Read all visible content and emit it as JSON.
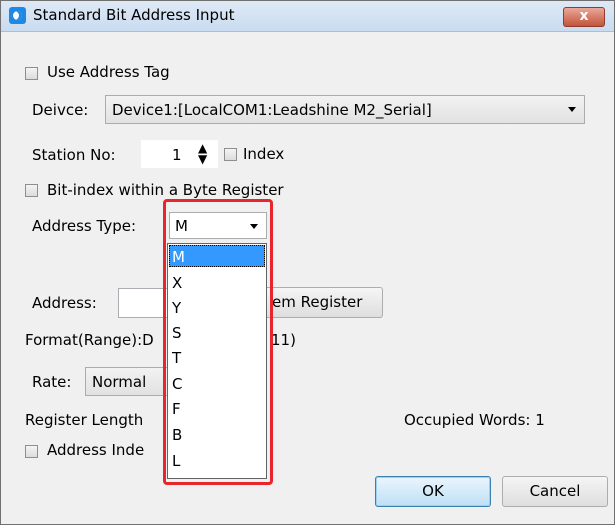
{
  "window": {
    "title": "Standard Bit Address Input",
    "close_label": "x"
  },
  "use_address_tag": {
    "label": "Use Address Tag",
    "checked": false
  },
  "device": {
    "label": "Deivce:",
    "value": "Device1:[LocalCOM1:Leadshine M2_Serial]"
  },
  "station": {
    "label": "Station No:",
    "value": "1",
    "index_label": "Index",
    "index_checked": false
  },
  "bit_index": {
    "label": "Bit-index within a Byte Register",
    "checked": false
  },
  "address_type": {
    "label": "Address Type:",
    "value": "M",
    "options": [
      "M",
      "X",
      "Y",
      "S",
      "T",
      "C",
      "F",
      "B",
      "L"
    ],
    "selected_index": 0
  },
  "address": {
    "label": "Address:",
    "value": "",
    "system_register_label": "System Register",
    "system_register_visible": "em Register"
  },
  "format": {
    "label_visible": "Format(Range):D",
    "range_visible": "11)"
  },
  "rate": {
    "label": "Rate:",
    "value": "Normal"
  },
  "register_length": {
    "label_visible": "Register Length"
  },
  "occupied_words": {
    "label": "Occupied Words: 1"
  },
  "address_index": {
    "label_visible": "Address Inde",
    "checked": false
  },
  "buttons": {
    "ok": "OK",
    "cancel": "Cancel"
  },
  "colors": {
    "selection": "#3399ff",
    "highlight_border": "#e8262b",
    "titlebar": "#c9dcf1"
  }
}
